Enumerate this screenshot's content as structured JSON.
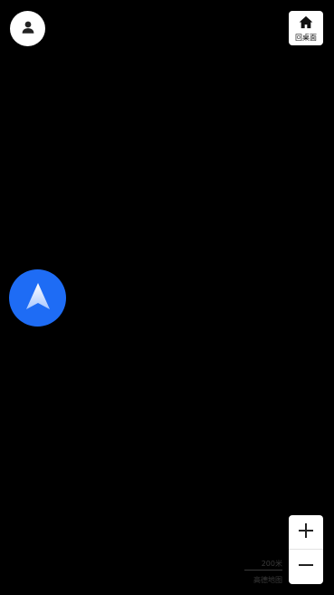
{
  "map": {
    "background_color": "#000000"
  },
  "profile_button": {
    "icon": "person-icon"
  },
  "home_button": {
    "icon": "home-icon",
    "label": "回桌面"
  },
  "location_marker": {
    "icon": "navigation-arrow-icon",
    "color": "#1e6cf5"
  },
  "zoom": {
    "zoom_in_icon": "plus-icon",
    "zoom_out_icon": "minus-icon"
  },
  "scale": {
    "text": "200米"
  },
  "attribution": {
    "text": "高德地图"
  }
}
